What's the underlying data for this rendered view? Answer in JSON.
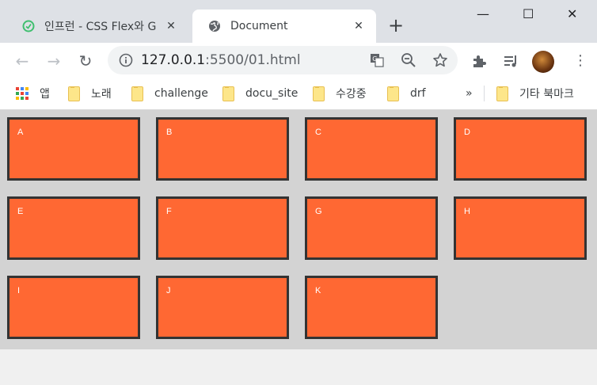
{
  "tabs": [
    {
      "label": "인프런 - CSS Flex와 G",
      "active": false,
      "favicon": "inflearn-icon"
    },
    {
      "label": "Document",
      "active": true,
      "favicon": "globe-icon"
    }
  ],
  "address": {
    "host": "127.0.0.1",
    "path": ":5500/01.html"
  },
  "bookmarks": [
    {
      "label": "앱",
      "icon": "apps-icon"
    },
    {
      "label": "노래",
      "icon": "folder-icon"
    },
    {
      "label": "challenge",
      "icon": "folder-icon"
    },
    {
      "label": "docu_site",
      "icon": "folder-icon"
    },
    {
      "label": "수강중",
      "icon": "folder-icon"
    },
    {
      "label": "drf",
      "icon": "folder-icon"
    },
    {
      "label": "»",
      "icon": ""
    },
    {
      "label": "기타 북마크",
      "icon": "folder-icon"
    }
  ],
  "items": [
    "A",
    "B",
    "C",
    "D",
    "E",
    "F",
    "G",
    "H",
    "I",
    "J",
    "K"
  ],
  "colors": {
    "item_bg": "#ff6833",
    "item_border": "#333333",
    "container_bg": "#d3d3d3"
  }
}
